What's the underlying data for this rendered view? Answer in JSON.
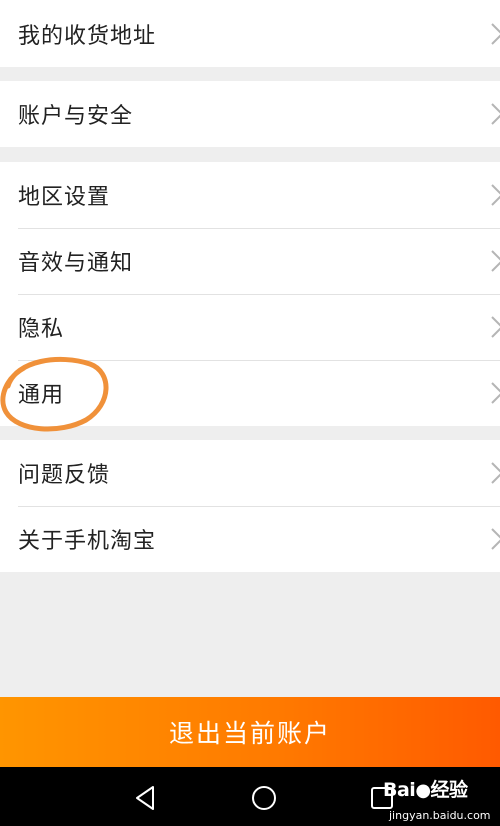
{
  "settings": {
    "group1": [
      {
        "label": "我的收货地址"
      }
    ],
    "group2": [
      {
        "label": "账户与安全"
      }
    ],
    "group3": [
      {
        "label": "地区设置"
      },
      {
        "label": "音效与通知"
      },
      {
        "label": "隐私"
      },
      {
        "label": "通用"
      }
    ],
    "group4": [
      {
        "label": "问题反馈"
      },
      {
        "label": "关于手机淘宝"
      }
    ]
  },
  "logout_label": "退出当前账户",
  "icons": {
    "row_chevron": "chevron-right-icon",
    "nav_back": "back-triangle-icon",
    "nav_home": "home-circle-icon",
    "nav_recent": "recent-square-icon"
  },
  "annotation": {
    "highlighted_item": "通用",
    "color": "#f0913a"
  },
  "watermark": {
    "brand": "Bai",
    "suffix": "经验",
    "url": "jingyan.baidu.com"
  },
  "colors": {
    "accent_start": "#ff9500",
    "accent_end": "#ff5a00",
    "page_bg": "#eeeeee",
    "nav_bg": "#000000"
  }
}
